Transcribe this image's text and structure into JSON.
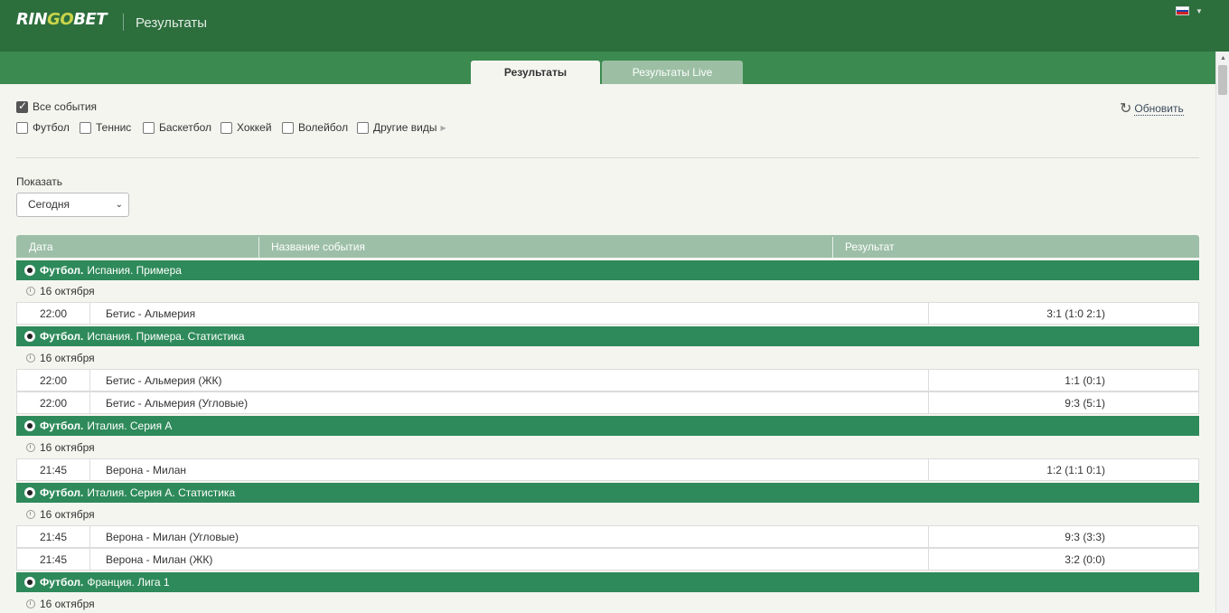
{
  "header": {
    "logo_pre": "RIN",
    "logo_go": "GO",
    "logo_post": "BET",
    "title": "Результаты",
    "language_icon": "russian-flag-icon"
  },
  "tabs": [
    {
      "label": "Результаты",
      "active": true
    },
    {
      "label": "Результаты Live",
      "active": false
    }
  ],
  "filters": {
    "all_events": {
      "label": "Все события",
      "checked": true
    },
    "sports": [
      {
        "label": "Футбол",
        "checked": false
      },
      {
        "label": "Теннис",
        "checked": false
      },
      {
        "label": "Баскетбол",
        "checked": false
      },
      {
        "label": "Хоккей",
        "checked": false
      },
      {
        "label": "Волейбол",
        "checked": false
      },
      {
        "label": "Другие виды",
        "checked": false
      }
    ],
    "refresh_label": "Обновить"
  },
  "show": {
    "label": "Показать",
    "selected": "Сегодня"
  },
  "table": {
    "headers": [
      "Дата",
      "Название события",
      "Результат"
    ],
    "groups": [
      {
        "sport": "Футбол.",
        "league": "Испания. Примера",
        "date": "16 октября",
        "rows": [
          {
            "time": "22:00",
            "name": "Бетис - Альмерия",
            "result": "3:1 (1:0 2:1)"
          }
        ]
      },
      {
        "sport": "Футбол.",
        "league": "Испания. Примера. Статистика",
        "date": "16 октября",
        "rows": [
          {
            "time": "22:00",
            "name": "Бетис - Альмерия (ЖК)",
            "result": "1:1 (0:1)"
          },
          {
            "time": "22:00",
            "name": "Бетис - Альмерия (Угловые)",
            "result": "9:3 (5:1)"
          }
        ]
      },
      {
        "sport": "Футбол.",
        "league": "Италия. Серия А",
        "date": "16 октября",
        "rows": [
          {
            "time": "21:45",
            "name": "Верона - Милан",
            "result": "1:2 (1:1 0:1)"
          }
        ]
      },
      {
        "sport": "Футбол.",
        "league": "Италия. Серия А. Статистика",
        "date": "16 октября",
        "rows": [
          {
            "time": "21:45",
            "name": "Верона - Милан (Угловые)",
            "result": "9:3 (3:3)"
          },
          {
            "time": "21:45",
            "name": "Верона - Милан (ЖК)",
            "result": "3:2 (0:0)"
          }
        ]
      },
      {
        "sport": "Футбол.",
        "league": "Франция. Лига 1",
        "date": "16 октября",
        "rows": []
      }
    ]
  }
}
